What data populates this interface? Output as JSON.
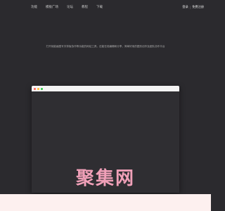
{
  "nav": {
    "links": [
      "功能",
      "模板广场",
      "论坛",
      "教程",
      "下载"
    ],
    "login_label": "登录",
    "separator": "|",
    "signup_label": "免费注册"
  },
  "intro": {
    "text": "打开就能画图写字排版协作等功能的网站工具，还能在线编辑和分享，简单好用的图形创作及团队协作平台"
  },
  "window": {
    "dots": [
      "red",
      "yellow",
      "green"
    ]
  },
  "watermark": {
    "text": "聚集网"
  },
  "colors": {
    "background": "#2b2a2e",
    "footer": "#fdf0ef",
    "watermark": "#f0a0b8"
  }
}
